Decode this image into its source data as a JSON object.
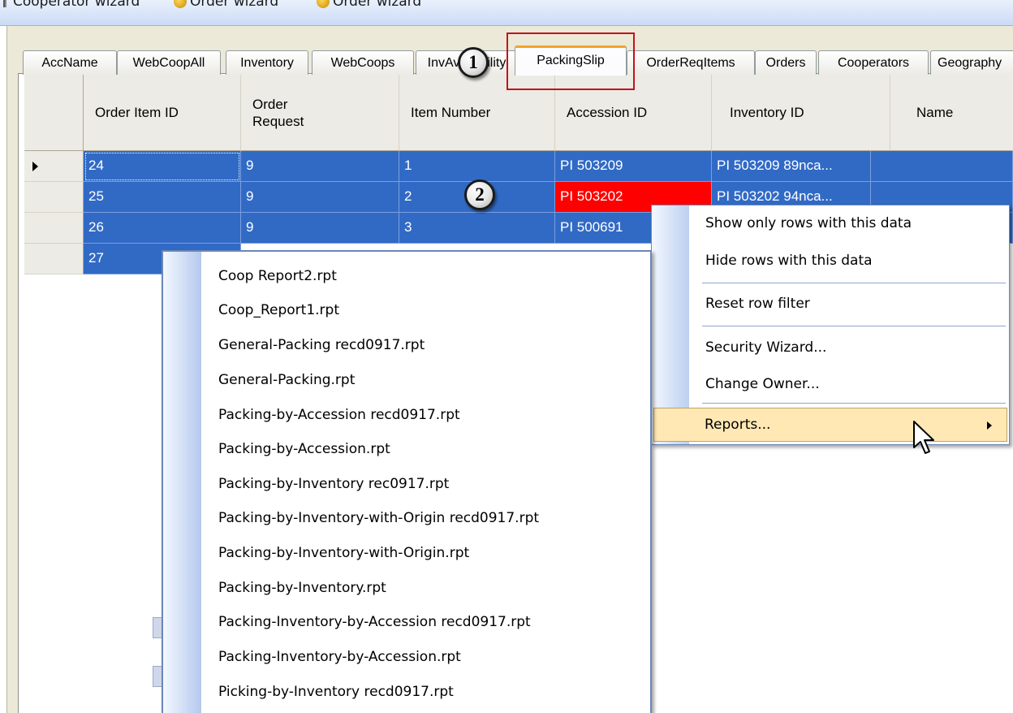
{
  "toolbar": {
    "items": [
      "Cooperator wizard",
      "Order wizard",
      "Order wizard"
    ]
  },
  "tabs": [
    {
      "label": "AccName"
    },
    {
      "label": "WebCoopAll"
    },
    {
      "label": "Inventory"
    },
    {
      "label": "WebCoops"
    },
    {
      "label": "InvAvailability"
    },
    {
      "label": "PackingSlip"
    },
    {
      "label": "OrderReqItems"
    },
    {
      "label": "Orders"
    },
    {
      "label": "Cooperators"
    },
    {
      "label": "Geography"
    }
  ],
  "active_tab": "PackingSlip",
  "callouts": [
    "1",
    "2"
  ],
  "grid": {
    "columns": [
      "Order Item ID",
      "Order Request",
      "Item Number",
      "Accession ID",
      "Inventory ID",
      "Name"
    ],
    "rows": [
      [
        "24",
        "9",
        "1",
        "PI 503209",
        "PI 503209 89nca...",
        ""
      ],
      [
        "25",
        "9",
        "2",
        "PI 503202",
        "PI 503202 94nca...",
        ""
      ],
      [
        "26",
        "9",
        "3",
        "PI 500691",
        "",
        ""
      ],
      [
        "27",
        "",
        "",
        "",
        "",
        ""
      ]
    ]
  },
  "context_menu": {
    "items": [
      "Show only rows with this data",
      "Hide rows with this data",
      "Reset row filter",
      "Security Wizard...",
      "Change Owner...",
      "Reports..."
    ]
  },
  "reports_menu": {
    "items": [
      "Coop Report2.rpt",
      "Coop_Report1.rpt",
      "General-Packing recd0917.rpt",
      "General-Packing.rpt",
      "Packing-by-Accession recd0917.rpt",
      "Packing-by-Accession.rpt",
      "Packing-by-Inventory rec0917.rpt",
      "Packing-by-Inventory-with-Origin recd0917.rpt",
      "Packing-by-Inventory-with-Origin.rpt",
      "Packing-by-Inventory.rpt",
      "Packing-Inventory-by-Accession recd0917.rpt",
      "Packing-Inventory-by-Accession.rpt",
      "Picking-by-Inventory recd0917.rpt"
    ]
  },
  "colors": {
    "selection": "#316ac5",
    "highlight_cell": "#ff0000",
    "callout_box": "#c4121b",
    "menu_hot": "#ffe8b3"
  }
}
